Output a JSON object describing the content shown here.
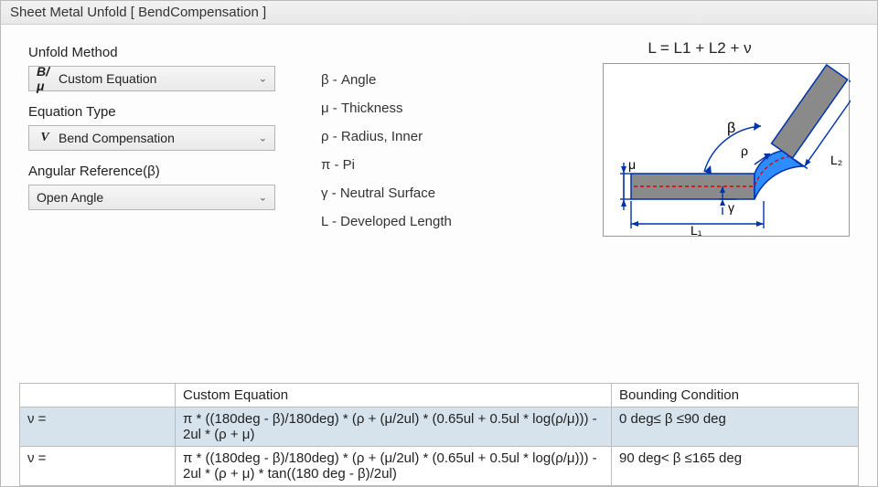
{
  "window_title": "Sheet Metal Unfold [ BendCompensation ]",
  "controls": {
    "unfold_method_label": "Unfold Method",
    "unfold_method_value": "Custom Equation",
    "equation_type_label": "Equation Type",
    "equation_type_value": "Bend Compensation",
    "angular_ref_label": "Angular Reference(β)",
    "angular_ref_value": "Open Angle"
  },
  "legend": {
    "beta": "β - Angle",
    "mu": "μ - Thickness",
    "rho": "ρ - Radius, Inner",
    "pi": "π - Pi",
    "gamma": "γ - Neutral Surface",
    "L": "L - Developed Length"
  },
  "formula": "L = L1 + L2 + ν",
  "diagram_labels": {
    "beta": "β",
    "rho": "ρ",
    "mu": "μ",
    "gamma": "γ",
    "L1": "L₁",
    "L2": "L₂"
  },
  "table": {
    "headers": {
      "var": "",
      "eq": "Custom Equation",
      "bound": "Bounding Condition"
    },
    "rows": [
      {
        "var": "ν =",
        "eq": "π * ((180deg - β)/180deg) * (ρ + (μ/2ul) * (0.65ul + 0.5ul * log(ρ/μ))) - 2ul * (ρ + μ)",
        "bound": "0 deg≤ β ≤90 deg",
        "selected": true
      },
      {
        "var": "ν =",
        "eq": "π * ((180deg - β)/180deg) * (ρ + (μ/2ul) * (0.65ul + 0.5ul * log(ρ/μ))) - 2ul * (ρ + μ) * tan((180 deg - β)/2ul)",
        "bound": "90 deg< β ≤165 deg",
        "selected": false
      }
    ]
  }
}
